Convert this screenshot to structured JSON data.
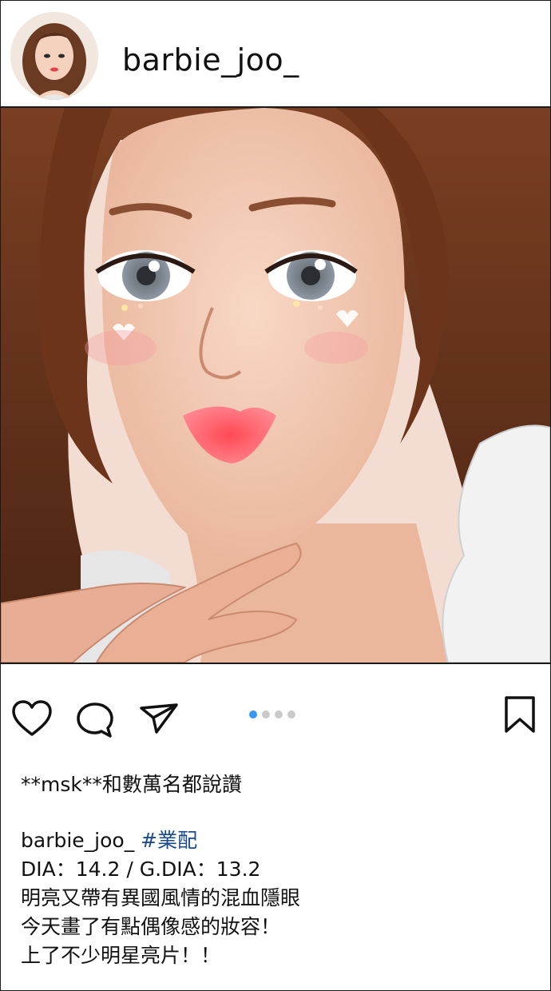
{
  "post": {
    "username": "barbie_joo_",
    "likes_text": "**msk**和數萬名都說讚",
    "caption": {
      "username": "barbie_joo_",
      "hashtag": "#業配",
      "lines": [
        "DIA：14.2 / G.DIA：13.2",
        "明亮又帶有異國風情的混血隱眼",
        "今天畫了有點偶像感的妝容！",
        "上了不少明星亮片！！"
      ]
    },
    "carousel": {
      "count": 4,
      "active_index": 0
    }
  },
  "icons": {
    "like": "heart-icon",
    "comment": "comment-bubble-icon",
    "share": "send-paper-plane-icon",
    "save": "bookmark-icon"
  },
  "colors": {
    "accent_dot": "#3897f0",
    "hashtag": "#1a4a8c",
    "border": "#1a1a1a"
  }
}
